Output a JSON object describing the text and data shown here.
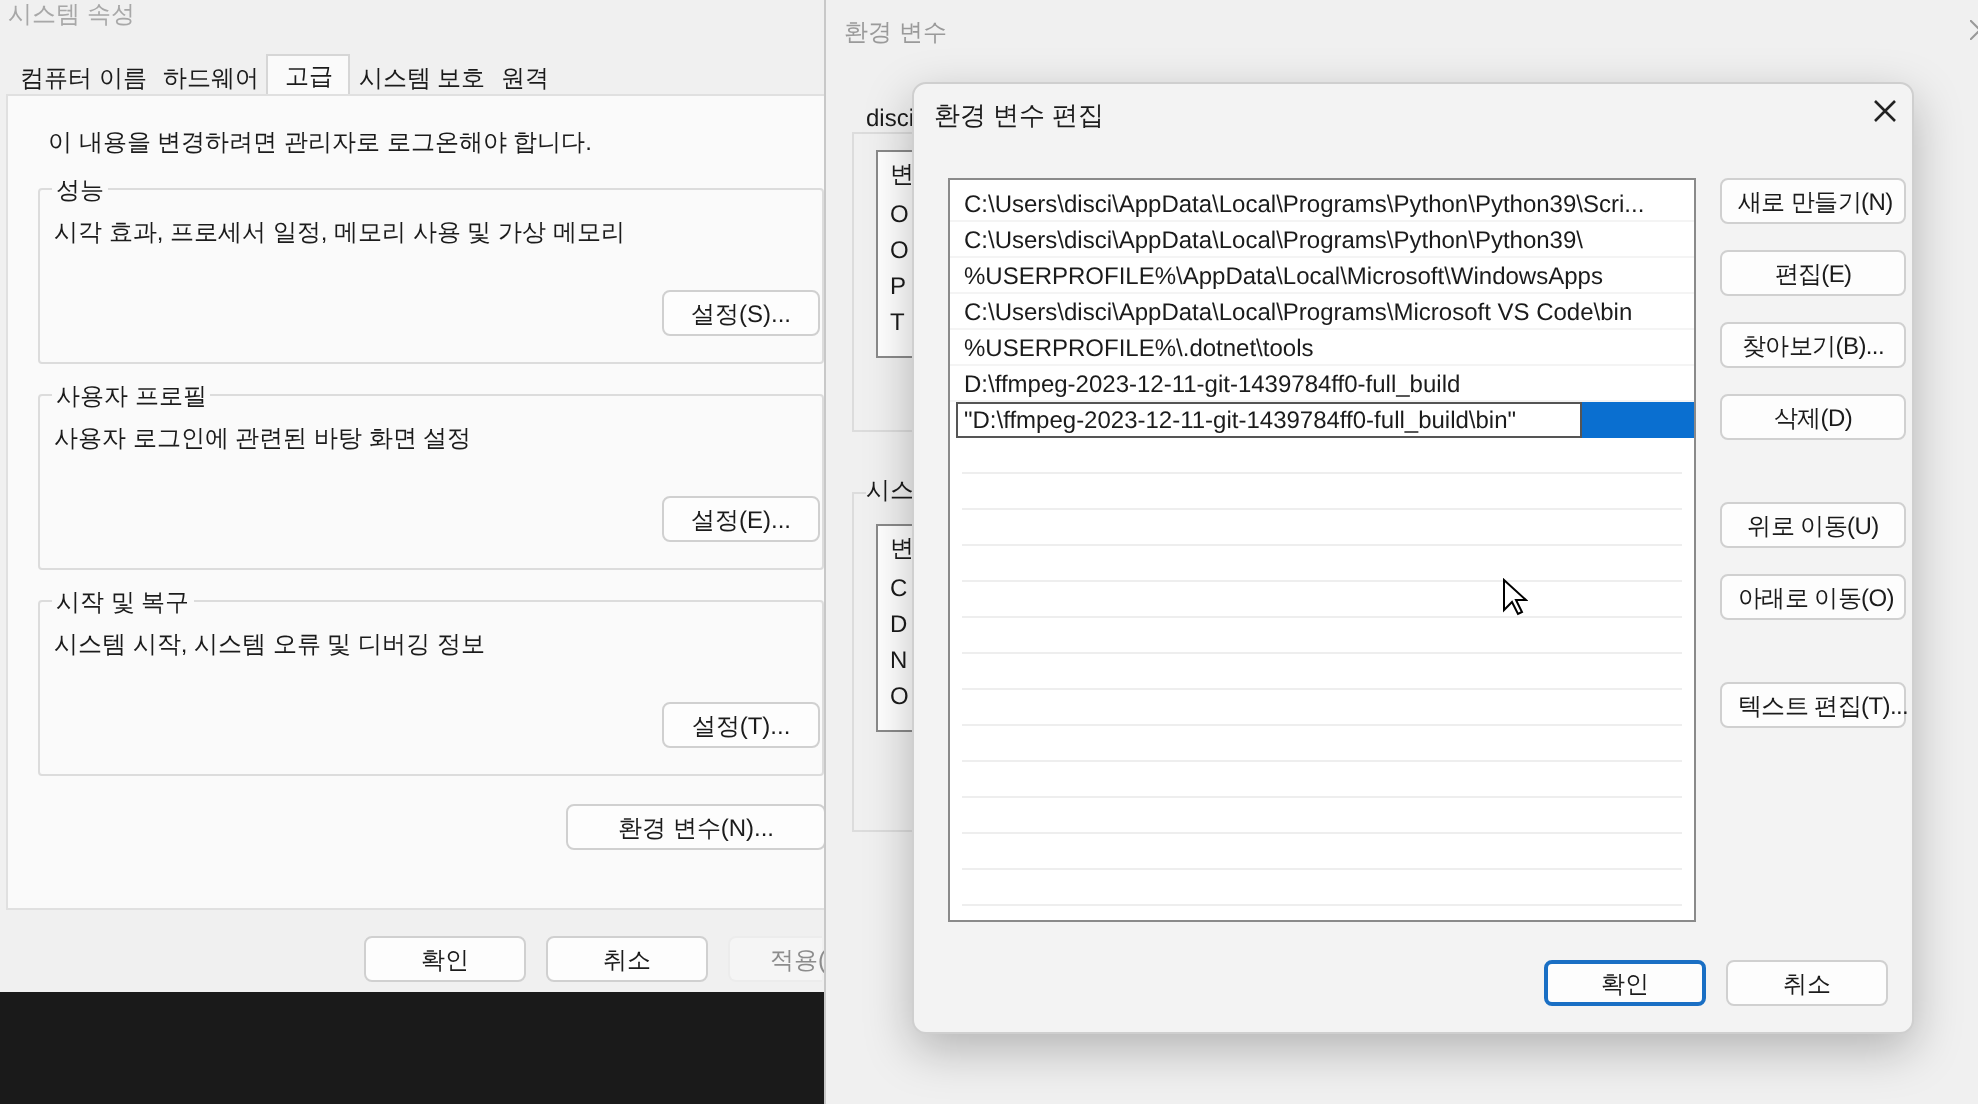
{
  "system_properties": {
    "title": "시스템 속성",
    "tabs": [
      {
        "label": "컴퓨터 이름",
        "selected": false
      },
      {
        "label": "하드웨어",
        "selected": false
      },
      {
        "label": "고급",
        "selected": true
      },
      {
        "label": "시스템 보호",
        "selected": false
      },
      {
        "label": "원격",
        "selected": false
      }
    ],
    "notice": "이 내용을 변경하려면 관리자로 로그온해야 합니다.",
    "groups": [
      {
        "title": "성능",
        "description": "시각 효과, 프로세서 일정, 메모리 사용 및 가상 메모리",
        "button": "설정(S)..."
      },
      {
        "title": "사용자 프로필",
        "description": "사용자 로그인에 관련된 바탕 화면 설정",
        "button": "설정(E)..."
      },
      {
        "title": "시작 및 복구",
        "description": "시스템 시작, 시스템 오류 및 디버깅 정보",
        "button": "설정(T)..."
      }
    ],
    "env_button": "환경 변수(N)...",
    "buttons": [
      {
        "label": "확인",
        "disabled": false
      },
      {
        "label": "취소",
        "disabled": false
      },
      {
        "label": "적용(",
        "disabled": true
      }
    ]
  },
  "environment_variables": {
    "title": "환경 변수",
    "user_label": "disci",
    "user_list": {
      "header": "변",
      "rows": [
        "O",
        "O",
        "P",
        "T"
      ]
    },
    "system_label": "시스",
    "system_list": {
      "header": "변",
      "rows": [
        "C",
        "D",
        "N",
        "O"
      ]
    }
  },
  "edit_dialog": {
    "title": "환경 변수 편집",
    "entries": [
      {
        "text": "C:\\Users\\disci\\AppData\\Local\\Programs\\Python\\Python39\\Scri...",
        "selected": false
      },
      {
        "text": "C:\\Users\\disci\\AppData\\Local\\Programs\\Python\\Python39\\",
        "selected": false
      },
      {
        "text": "%USERPROFILE%\\AppData\\Local\\Microsoft\\WindowsApps",
        "selected": false
      },
      {
        "text": "C:\\Users\\disci\\AppData\\Local\\Programs\\Microsoft VS Code\\bin",
        "selected": false
      },
      {
        "text": "%USERPROFILE%\\.dotnet\\tools",
        "selected": false
      },
      {
        "text": "D:\\ffmpeg-2023-12-11-git-1439784ff0-full_build",
        "selected": false
      },
      {
        "text": "\"D:\\ffmpeg-2023-12-11-git-1439784ff0-full_build\\bin\"",
        "selected": true
      }
    ],
    "side_buttons": [
      [
        "새로 만들기(N)",
        "편집(E)",
        "찾아보기(B)...",
        "삭제(D)"
      ],
      [
        "위로 이동(U)",
        "아래로 이동(O)"
      ],
      [
        "텍스트 편집(T)..."
      ]
    ],
    "buttons": [
      {
        "label": "확인",
        "default": true
      },
      {
        "label": "취소",
        "default": false
      }
    ]
  }
}
